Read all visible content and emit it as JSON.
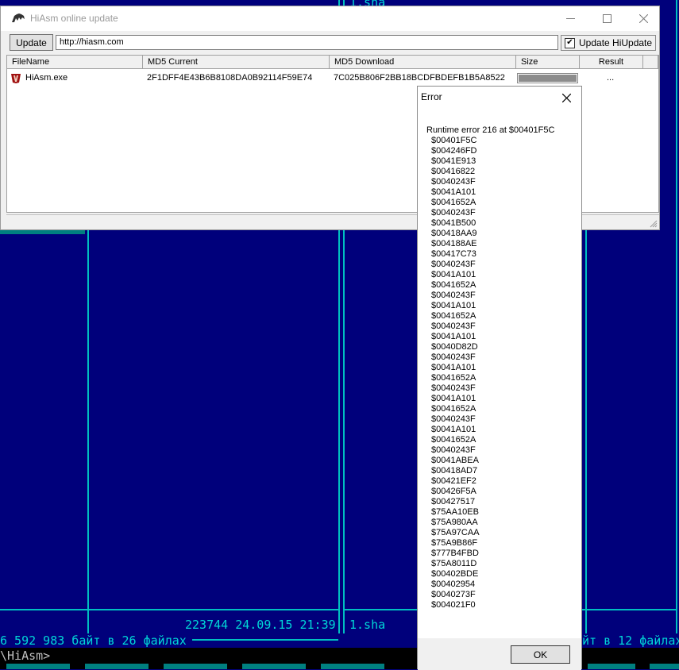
{
  "far": {
    "top_file": "1.sha",
    "info_line": "223744 24.09.15 21:39",
    "info_file": "1.sha",
    "left_summary": "6 592 983 байт в 26 файлах",
    "right_summary": "йт в 12 файлах",
    "command_line": "\\HiAsm>",
    "colors": {
      "background": "#00007b",
      "frame": "#00c0c0",
      "text": "#00d7d7",
      "teal": "#008080"
    }
  },
  "updater": {
    "title": "HiAsm online update",
    "icon": "hiasm-logo-icon",
    "update_button": "Update",
    "url_value": "http://hiasm.com",
    "checkbox_label": "Update HiUpdate",
    "checkbox_checked": true,
    "columns": [
      "FileName",
      "MD5 Current",
      "MD5 Download",
      "Size",
      "Result"
    ],
    "rows": [
      {
        "filename": "HiAsm.exe",
        "md5_current": "2F1DFF4E43B6B8108DA0B92114F59E74",
        "md5_download": "7C025B806F2BB18BCDFBDEFB1B5A8522",
        "progress": 1.0,
        "result": "..."
      }
    ]
  },
  "error_dialog": {
    "title": "Error",
    "message": "Runtime error 216 at $00401F5C",
    "addresses": [
      "$00401F5C",
      "$004246FD",
      "$0041E913",
      "$00416822",
      "$0040243F",
      "$0041A101",
      "$0041652A",
      "$0040243F",
      "$0041B500",
      "$00418AA9",
      "$004188AE",
      "$00417C73",
      "$0040243F",
      "$0041A101",
      "$0041652A",
      "$0040243F",
      "$0041A101",
      "$0041652A",
      "$0040243F",
      "$0041A101",
      "$0040D82D",
      "$0040243F",
      "$0041A101",
      "$0041652A",
      "$0040243F",
      "$0041A101",
      "$0041652A",
      "$0040243F",
      "$0041A101",
      "$0041652A",
      "$0040243F",
      "$0041ABEA",
      "$00418AD7",
      "$00421EF2",
      "$00426F5A",
      "$00427517",
      "$75AA10EB",
      "$75A980AA",
      "$75A97CAA",
      "$75A9B86F",
      "$777B4FBD",
      "$75A8011D",
      "$00402BDE",
      "$00402954",
      "$0040273F",
      "$004021F0"
    ],
    "ok_label": "OK"
  }
}
